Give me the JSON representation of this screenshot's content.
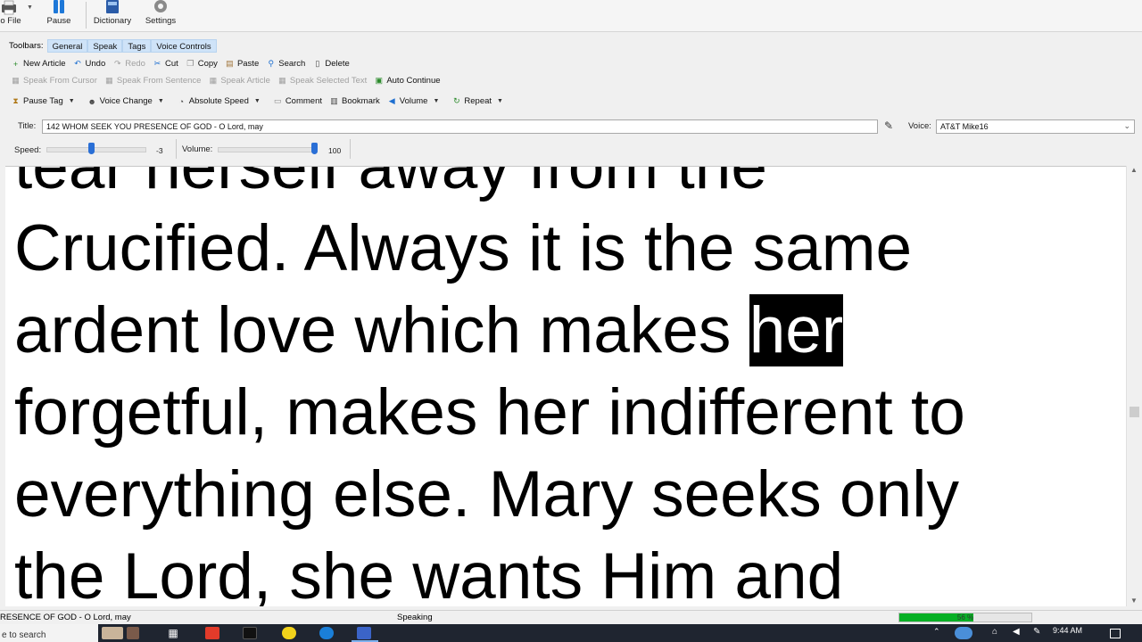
{
  "ribbon": {
    "file_partial": "o File",
    "pause": "Pause",
    "dictionary": "Dictionary",
    "settings": "Settings"
  },
  "toolbars": {
    "label": "Toolbars:",
    "tabs": [
      "General",
      "Speak",
      "Tags",
      "Voice Controls"
    ]
  },
  "general_row": {
    "new_article": "New Article",
    "undo": "Undo",
    "redo": "Redo",
    "cut": "Cut",
    "copy": "Copy",
    "paste": "Paste",
    "search": "Search",
    "delete": "Delete"
  },
  "speak_row": {
    "speak_from_cursor": "Speak From Cursor",
    "speak_from_sentence": "Speak From Sentence",
    "speak_article": "Speak Article",
    "speak_selected_text": "Speak Selected Text",
    "auto_continue": "Auto Continue"
  },
  "tags_row": {
    "pause_tag": "Pause Tag",
    "voice_change": "Voice Change",
    "absolute_speed": "Absolute Speed",
    "comment": "Comment",
    "bookmark": "Bookmark",
    "volume": "Volume",
    "repeat": "Repeat"
  },
  "title_row": {
    "label": "Title:",
    "value": "142 WHOM SEEK YOU PRESENCE OF GOD - O Lord, may",
    "voice_label": "Voice:",
    "voice_value": "AT&T Mike16"
  },
  "sliders": {
    "speed_label": "Speed:",
    "speed_value": "-3",
    "volume_label": "Volume:",
    "volume_value": "100"
  },
  "document": {
    "line1": "tear herself away from the",
    "line2": "Crucified. Always it is the same",
    "line3_before": "ardent love which makes ",
    "line3_highlight": "her",
    "line4": "forgetful, makes her indifferent to",
    "line5": "everything else. Mary seeks only",
    "line6": "the Lord, she wants Him and"
  },
  "status": {
    "title": "RESENCE OF GOD - O Lord, may",
    "state": "Speaking",
    "progress_text": "56 %",
    "progress_fraction": 0.56
  },
  "taskbar": {
    "search_text": "e to search",
    "clock": "9:44 AM"
  },
  "colors": {
    "accent": "#2a6fd6",
    "progress": "#06b025",
    "tab_bg": "#cfe3f8",
    "highlight_bg": "#000000"
  }
}
